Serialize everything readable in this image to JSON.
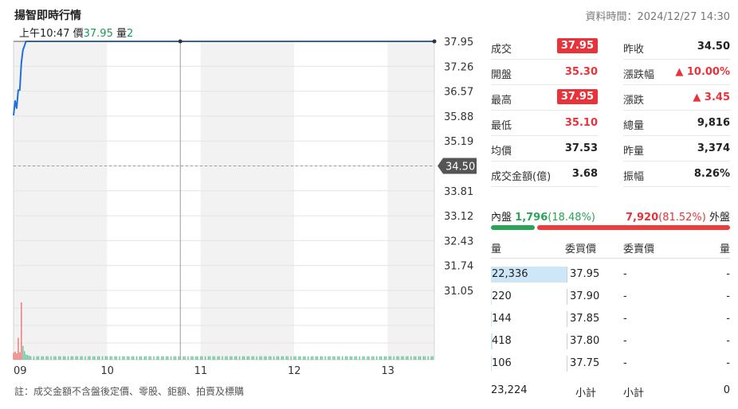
{
  "header": {
    "title": "揚智即時行情",
    "data_time": "資料時間：2024/12/27 14:30"
  },
  "tooltip": {
    "time_label": "上午10:47",
    "price_label": "價",
    "price": "37.95",
    "volume_label": "量",
    "volume": "2"
  },
  "chart_data": {
    "type": "line",
    "x_ticks": [
      "09",
      "10",
      "11",
      "12",
      "13"
    ],
    "y_ticks": [
      37.95,
      37.26,
      36.57,
      35.88,
      35.19,
      34.5,
      33.81,
      33.12,
      32.43,
      31.74,
      31.05
    ],
    "ylim": [
      31.05,
      37.95
    ],
    "reference_price": 34.5,
    "reference_label": "34.50",
    "grid": true,
    "price_series": {
      "x_minutes": [
        0,
        1,
        2,
        3,
        4,
        5,
        6,
        8,
        10,
        14,
        40,
        100,
        160,
        210,
        270
      ],
      "values": [
        35.9,
        36.3,
        36.1,
        36.6,
        36.6,
        37.35,
        37.7,
        37.95,
        37.95,
        37.95,
        37.95,
        37.95,
        37.95,
        37.95,
        37.95
      ]
    },
    "volume_series": {
      "x_minutes": [
        0,
        1,
        2,
        3,
        4,
        5,
        6,
        7,
        8,
        9,
        10
      ],
      "values": [
        12,
        14,
        11,
        38,
        13,
        100,
        24,
        15,
        9,
        8,
        7
      ],
      "baseline_value": 6
    },
    "cursor_minute": 107,
    "colors": {
      "line": "#1f6fdc",
      "volume": "#5cc091",
      "volume_high": "#ef6a6a",
      "shade": "#f2f2f2"
    }
  },
  "quote": {
    "left": [
      {
        "label": "成交",
        "value": "37.95",
        "style": "badge"
      },
      {
        "label": "開盤",
        "value": "35.30",
        "style": "red"
      },
      {
        "label": "最高",
        "value": "37.95",
        "style": "badge"
      },
      {
        "label": "最低",
        "value": "35.10",
        "style": "red"
      },
      {
        "label": "均價",
        "value": "37.53",
        "style": "black"
      },
      {
        "label": "成交金額(億)",
        "value": "3.68",
        "style": "black"
      }
    ],
    "right": [
      {
        "label": "昨收",
        "value": "34.50",
        "style": "black"
      },
      {
        "label": "漲跌幅",
        "value": "▲ 10.00%",
        "style": "red"
      },
      {
        "label": "漲跌",
        "value": "▲ 3.45",
        "style": "red"
      },
      {
        "label": "總量",
        "value": "9,816",
        "style": "black"
      },
      {
        "label": "昨量",
        "value": "3,374",
        "style": "black"
      },
      {
        "label": "振幅",
        "value": "8.26%",
        "style": "black"
      }
    ]
  },
  "inout": {
    "inner_label": "內盤",
    "inner_value": "1,796",
    "inner_pct": "(18.48%)",
    "outer_value": "7,920",
    "outer_pct": "(81.52%)",
    "outer_label": "外盤",
    "inner_ratio": 0.1848,
    "inner_color": "#2aa455",
    "outer_color": "#f03b3b"
  },
  "orderbook": {
    "headers": {
      "vol": "量",
      "bid": "委買價",
      "ask": "委賣價",
      "ask_vol": "量"
    },
    "rows": [
      {
        "bid_vol": "22,336",
        "bid_ratio": 1.0,
        "bid": "37.95",
        "ask": "-",
        "ask_vol": "-"
      },
      {
        "bid_vol": "220",
        "bid_ratio": 0.01,
        "bid": "37.90",
        "ask": "-",
        "ask_vol": "-"
      },
      {
        "bid_vol": "144",
        "bid_ratio": 0.006,
        "bid": "37.85",
        "ask": "-",
        "ask_vol": "-"
      },
      {
        "bid_vol": "418",
        "bid_ratio": 0.019,
        "bid": "37.80",
        "ask": "-",
        "ask_vol": "-"
      },
      {
        "bid_vol": "106",
        "bid_ratio": 0.005,
        "bid": "37.75",
        "ask": "-",
        "ask_vol": "-"
      }
    ],
    "footer": {
      "bid_total": "23,224",
      "bid_label": "小計",
      "ask_label": "小計",
      "ask_total": "0"
    }
  },
  "note": "註：成交金額不含盤後定價、零股、鉅額、拍賣及標購"
}
